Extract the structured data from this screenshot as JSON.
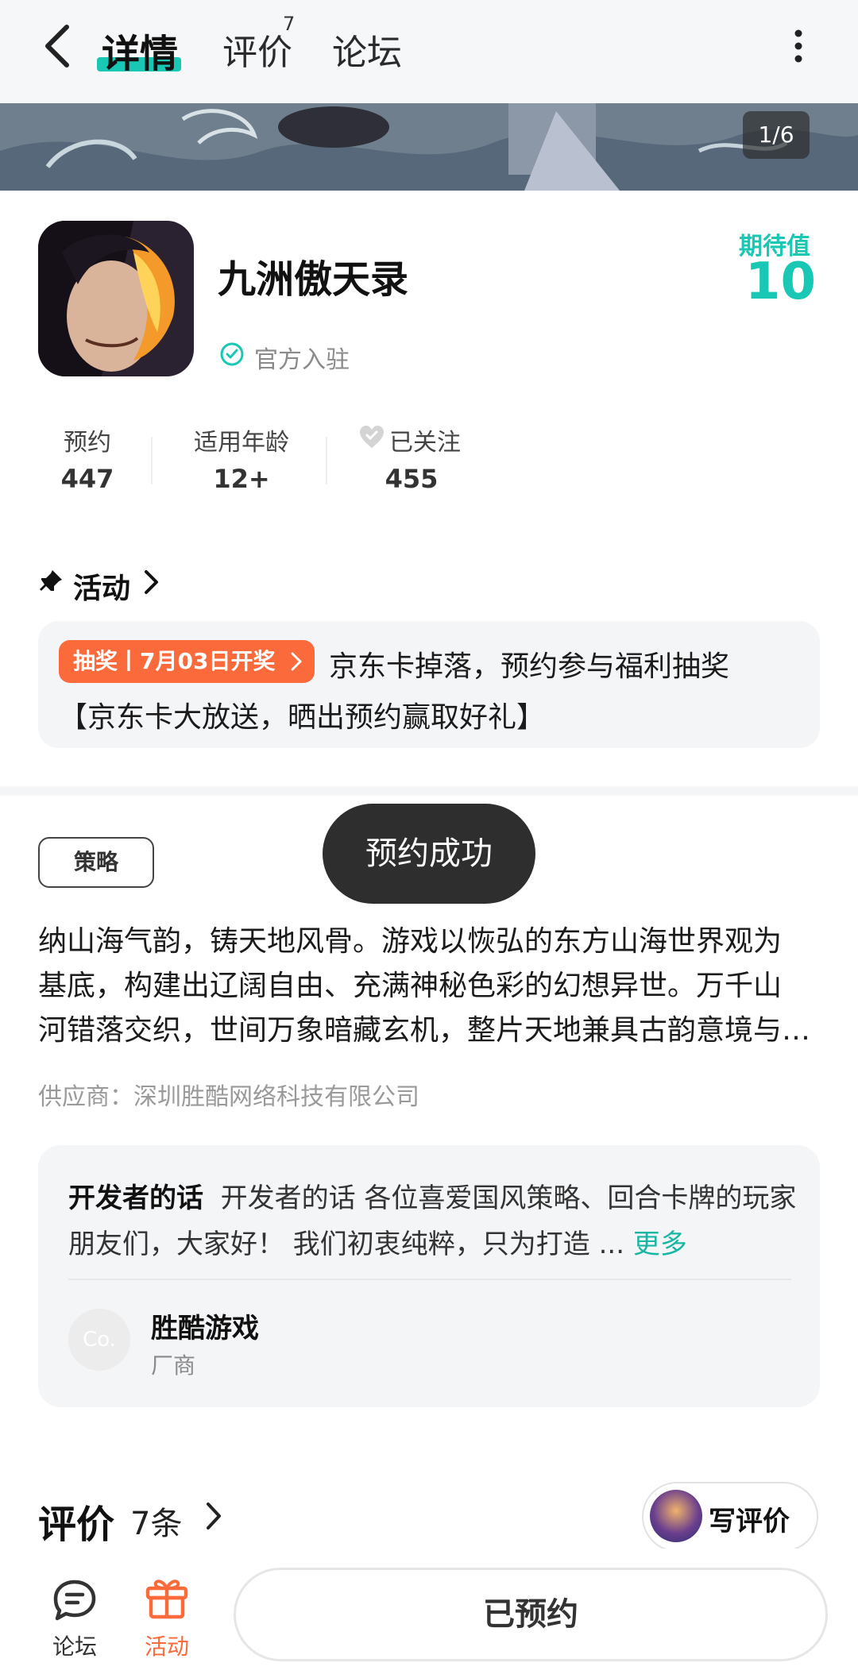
{
  "header": {
    "tabs": [
      {
        "label": "详情",
        "active": true
      },
      {
        "label": "评价",
        "badge": "7"
      },
      {
        "label": "论坛"
      }
    ],
    "icons": {
      "back": "back-arrow-icon",
      "more": "more-vertical-icon"
    }
  },
  "banner": {
    "pager": "1/6"
  },
  "app": {
    "title": "九洲傲天录",
    "official": "官方入驻",
    "expect_label": "期待值",
    "expect_value": "10",
    "stats": [
      {
        "label": "预约",
        "value": "447"
      },
      {
        "label": "适用年龄",
        "value": "12+"
      },
      {
        "label": "已关注",
        "value": "455"
      }
    ]
  },
  "activity": {
    "title": "活动",
    "tag": "抽奖丨7月03日开奖",
    "line1": "京东卡掉落，预约参与福利抽奖",
    "line2": "【京东卡大放送，晒出预约赢取好礼】"
  },
  "toast": "预约成功",
  "genre_tag": "策略",
  "description": [
    "纳山海气韵，铸天地风骨。游戏以恢弘的东方山海世界观为",
    "基底，构建出辽阔自由、充满神秘色彩的幻想异世。万千山",
    "河错落交织，世间万象暗藏玄机，整片天地兼具古韵意境与…"
  ],
  "supplier": "供应商：深圳胜酷网络科技有限公司",
  "developer": {
    "heading": "开发者的话",
    "text": "开发者的话 各位喜爱国风策略、回合卡牌的玩家朋友们，大家好！ 我们初衷纯粹，只为打造 ...",
    "more": "更多",
    "company_avatar": "Co.",
    "company_name": "胜酷游戏",
    "company_role": "厂商"
  },
  "reviews": {
    "title": "评价",
    "count": "7条",
    "write_label": "写评价"
  },
  "bottom_nav": {
    "items": [
      {
        "label": "论坛",
        "icon": "forum-chat-icon",
        "color": "#333333"
      },
      {
        "label": "活动",
        "icon": "gift-icon",
        "color": "#fb6a3b"
      }
    ],
    "reserved_button": "已预约"
  },
  "colors": {
    "accent": "#19c8b4",
    "orange": "#fb6a3b"
  }
}
